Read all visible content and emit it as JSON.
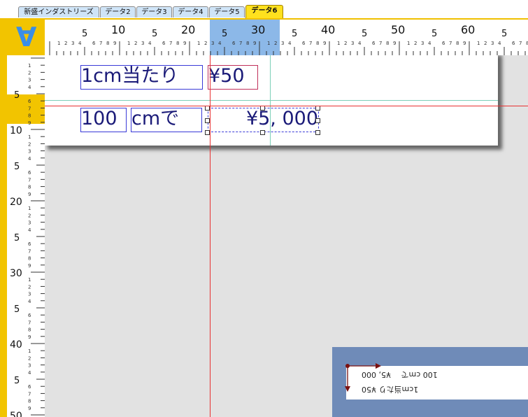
{
  "tabs": [
    {
      "label": "新盛インダストリーズ",
      "active": false
    },
    {
      "label": "データ2",
      "active": false
    },
    {
      "label": "データ3",
      "active": false
    },
    {
      "label": "データ4",
      "active": false
    },
    {
      "label": "データ5",
      "active": false
    },
    {
      "label": "データ6",
      "active": true
    }
  ],
  "ruler": {
    "h_major": [
      "5",
      "10",
      "5",
      "20",
      "5",
      "30",
      "5",
      "40",
      "5",
      "50",
      "5",
      "60",
      "5",
      "7"
    ],
    "h_minor": "1 2 3 4 | 6 7 8 9 |",
    "v_major": [
      "5",
      "10",
      "5",
      "20",
      "5",
      "30",
      "5",
      "40",
      "5",
      "50"
    ],
    "v_minor": [
      "1",
      "2",
      "3",
      "4",
      "6",
      "7",
      "8",
      "9"
    ]
  },
  "document": {
    "row1": {
      "label": "1cm当たり",
      "price": "¥50"
    },
    "row2": {
      "qty": "100",
      "unit": "cmで",
      "total": "¥5, 000"
    }
  },
  "preview": {
    "line1": "100 cmで　 ¥5, 000",
    "line2": "1cm当たり ¥50"
  },
  "colors": {
    "tab_active": "#ffe11e",
    "tab_bg": "#cfe4f7",
    "ruler_yellow": "#f2c400",
    "ruler_highlight": "#8cb8e8",
    "guide_red": "#e83030",
    "guide_teal": "#7ccfb8",
    "box_blue": "#3a3ad8",
    "preview_bg": "#6f8bb8"
  }
}
